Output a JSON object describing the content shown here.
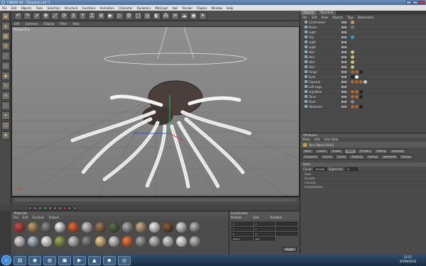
{
  "window": {
    "title": "CINEMA 4D - [Tarantula.c4d *]"
  },
  "menubar": [
    "File",
    "Edit",
    "Objects",
    "Tools",
    "Selection",
    "Structure",
    "Functions",
    "Animation",
    "Character",
    "Dynamics",
    "MoGraph",
    "Hair",
    "Render",
    "Plugins",
    "Window",
    "Help"
  ],
  "viewport": {
    "menu": [
      "Edit",
      "Cameras",
      "Display",
      "Filter",
      "View"
    ],
    "label": "Perspective"
  },
  "objects": {
    "tabs": [
      "Objects",
      "Structure"
    ],
    "menu": [
      "File",
      "Edit",
      "View",
      "Objects",
      "Tags",
      "Bookmarks"
    ],
    "rows": [
      "Camtracker",
      "Rocks",
      "Light",
      "Sky",
      "Light",
      "Light",
      "Hair",
      "Hair",
      "Hair",
      "Hair",
      "Fangs",
      "Eyes",
      "Capsule",
      "Left Legs",
      "Leg Base",
      "Torso",
      "Floor",
      "Abdomen"
    ]
  },
  "attributes": {
    "header": "Attributes",
    "menu": [
      "Mode",
      "Edit",
      "User Data"
    ],
    "object_title": "Hair Object [Hair]",
    "tabs": [
      "Basic",
      "Coord.",
      "Guides",
      "Hairs",
      "Fill Hairs",
      "Editing",
      "Generate",
      "Dynamics",
      "Forces",
      "Cache",
      "Shading",
      "Culling",
      "Advanced",
      "Pricing"
    ],
    "section": "Hairs",
    "count_label": "Count",
    "count_value": "100000",
    "segments_label": "Segments",
    "segments_value": "12",
    "collapsed": [
      "Root",
      "Growth",
      "Cloning",
      "Interpolation"
    ]
  },
  "materials": {
    "header": "Materials",
    "menu": [
      "File",
      "Edit",
      "Function",
      "Texture"
    ]
  },
  "coordinates": {
    "header": "Coordinates",
    "columns": [
      "Position",
      "Size",
      "Rotation"
    ],
    "fields": [
      "X",
      "Y",
      "Z"
    ],
    "mode_left": "Object",
    "mode_right": "Size",
    "apply": "Apply"
  },
  "taskbar": {
    "time": "21:57",
    "date": "07/09/2010"
  }
}
